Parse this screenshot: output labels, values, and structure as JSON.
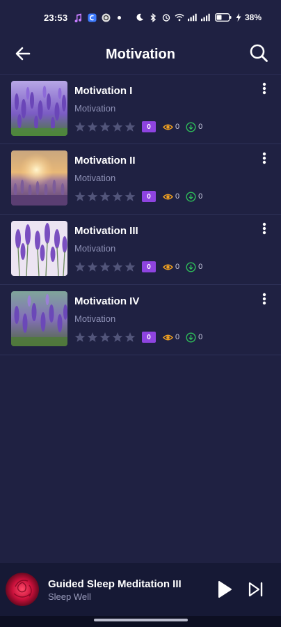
{
  "status_bar": {
    "time": "23:53",
    "battery": "38%"
  },
  "header": {
    "title": "Motivation",
    "back_icon": "arrow-left-icon",
    "search_icon": "search-icon"
  },
  "items": [
    {
      "title": "Motivation I",
      "subtitle": "Motivation",
      "rating": 0,
      "badge": "0",
      "views": "0",
      "downloads": "0"
    },
    {
      "title": "Motivation II",
      "subtitle": "Motivation",
      "rating": 0,
      "badge": "0",
      "views": "0",
      "downloads": "0"
    },
    {
      "title": "Motivation III",
      "subtitle": "Motivation",
      "rating": 0,
      "badge": "0",
      "views": "0",
      "downloads": "0"
    },
    {
      "title": "Motivation IV",
      "subtitle": "Motivation",
      "rating": 0,
      "badge": "0",
      "views": "0",
      "downloads": "0"
    }
  ],
  "player": {
    "title": "Guided Sleep Meditation III",
    "subtitle": "Sleep Well",
    "play_icon": "play-icon",
    "next_icon": "skip-next-icon"
  },
  "colors": {
    "background": "#1f2142",
    "badge": "#8e44e0",
    "views_icon": "#f0a020",
    "downloads_icon": "#2fbf5a",
    "star_empty": "#52557a"
  }
}
